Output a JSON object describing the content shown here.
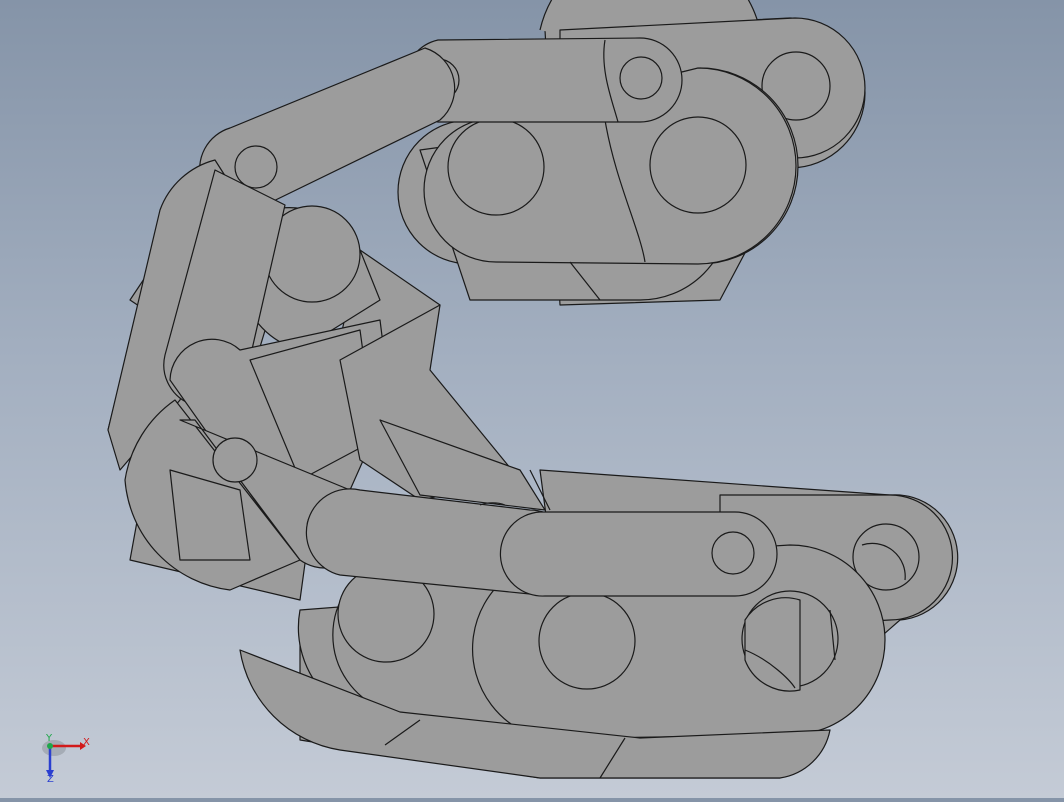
{
  "colors": {
    "part_fill": "#9c9c9c",
    "edge": "#1a1a1a",
    "axis_x": "#d21a1a",
    "axis_y": "#1fa64a",
    "axis_z": "#2a3fd0"
  },
  "triad": {
    "x_label": "X",
    "y_label": "Y",
    "z_label": "Z"
  }
}
